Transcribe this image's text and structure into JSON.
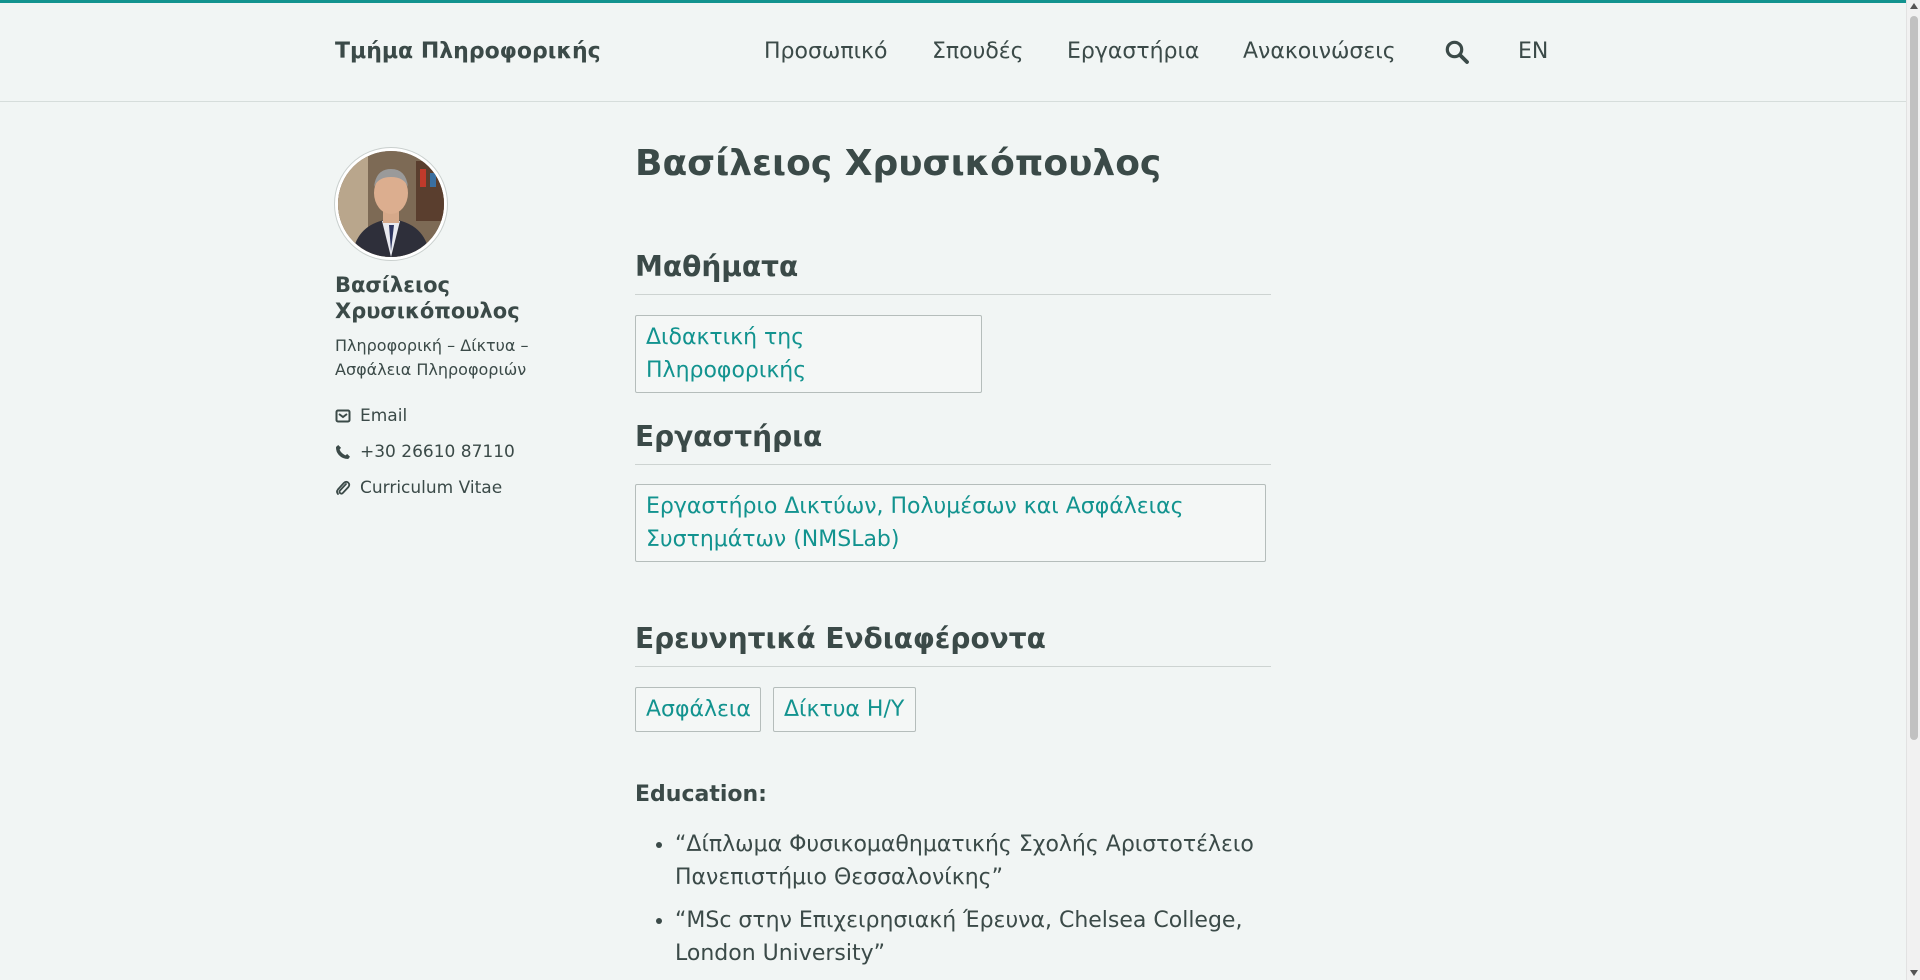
{
  "header": {
    "brand": "Τμήμα Πληροφορικής",
    "nav": [
      "Προσωπικό",
      "Σπουδές",
      "Εργαστήρια",
      "Ανακοινώσεις"
    ],
    "search_icon": "search-icon",
    "language": "EN"
  },
  "sidebar": {
    "name": "Βασίλειος Χρυσικόπουλος",
    "role": "Πληροφορική – Δίκτυα – Ασφάλεια Πληροφοριών",
    "contacts": [
      {
        "icon": "envelope-icon",
        "label": "Email"
      },
      {
        "icon": "phone-icon",
        "label": "+30 26610 87110"
      },
      {
        "icon": "paperclip-icon",
        "label": "Curriculum Vitae"
      }
    ]
  },
  "main": {
    "title": "Βασίλειος Χρυσικόπουλος",
    "courses": {
      "heading": "Μαθήματα",
      "items": [
        "Διδακτική της Πληροφορικής"
      ]
    },
    "labs": {
      "heading": "Εργαστήρια",
      "items": [
        "Εργαστήριο Δικτύων, Πολυμέσων και Ασφάλειας Συστημάτων (NMSLab)"
      ]
    },
    "research": {
      "heading": "Ερευνητικά Ενδιαφέροντα",
      "items": [
        "Ασφάλεια",
        "Δίκτυα Η/Υ"
      ]
    },
    "education": {
      "heading": "Education:",
      "items": [
        "“Δίπλωμα Φυσικομαθηματικής Σχολής Αριστοτέλειο Πανεπιστήμιο Θεσσαλονίκης”",
        "“MSc στην Επιχειρησιακή Έρευνα, Chelsea College, London University”"
      ]
    }
  },
  "colors": {
    "accent": "#12938f",
    "text": "#3b4a48",
    "background": "#f1f5f4"
  }
}
